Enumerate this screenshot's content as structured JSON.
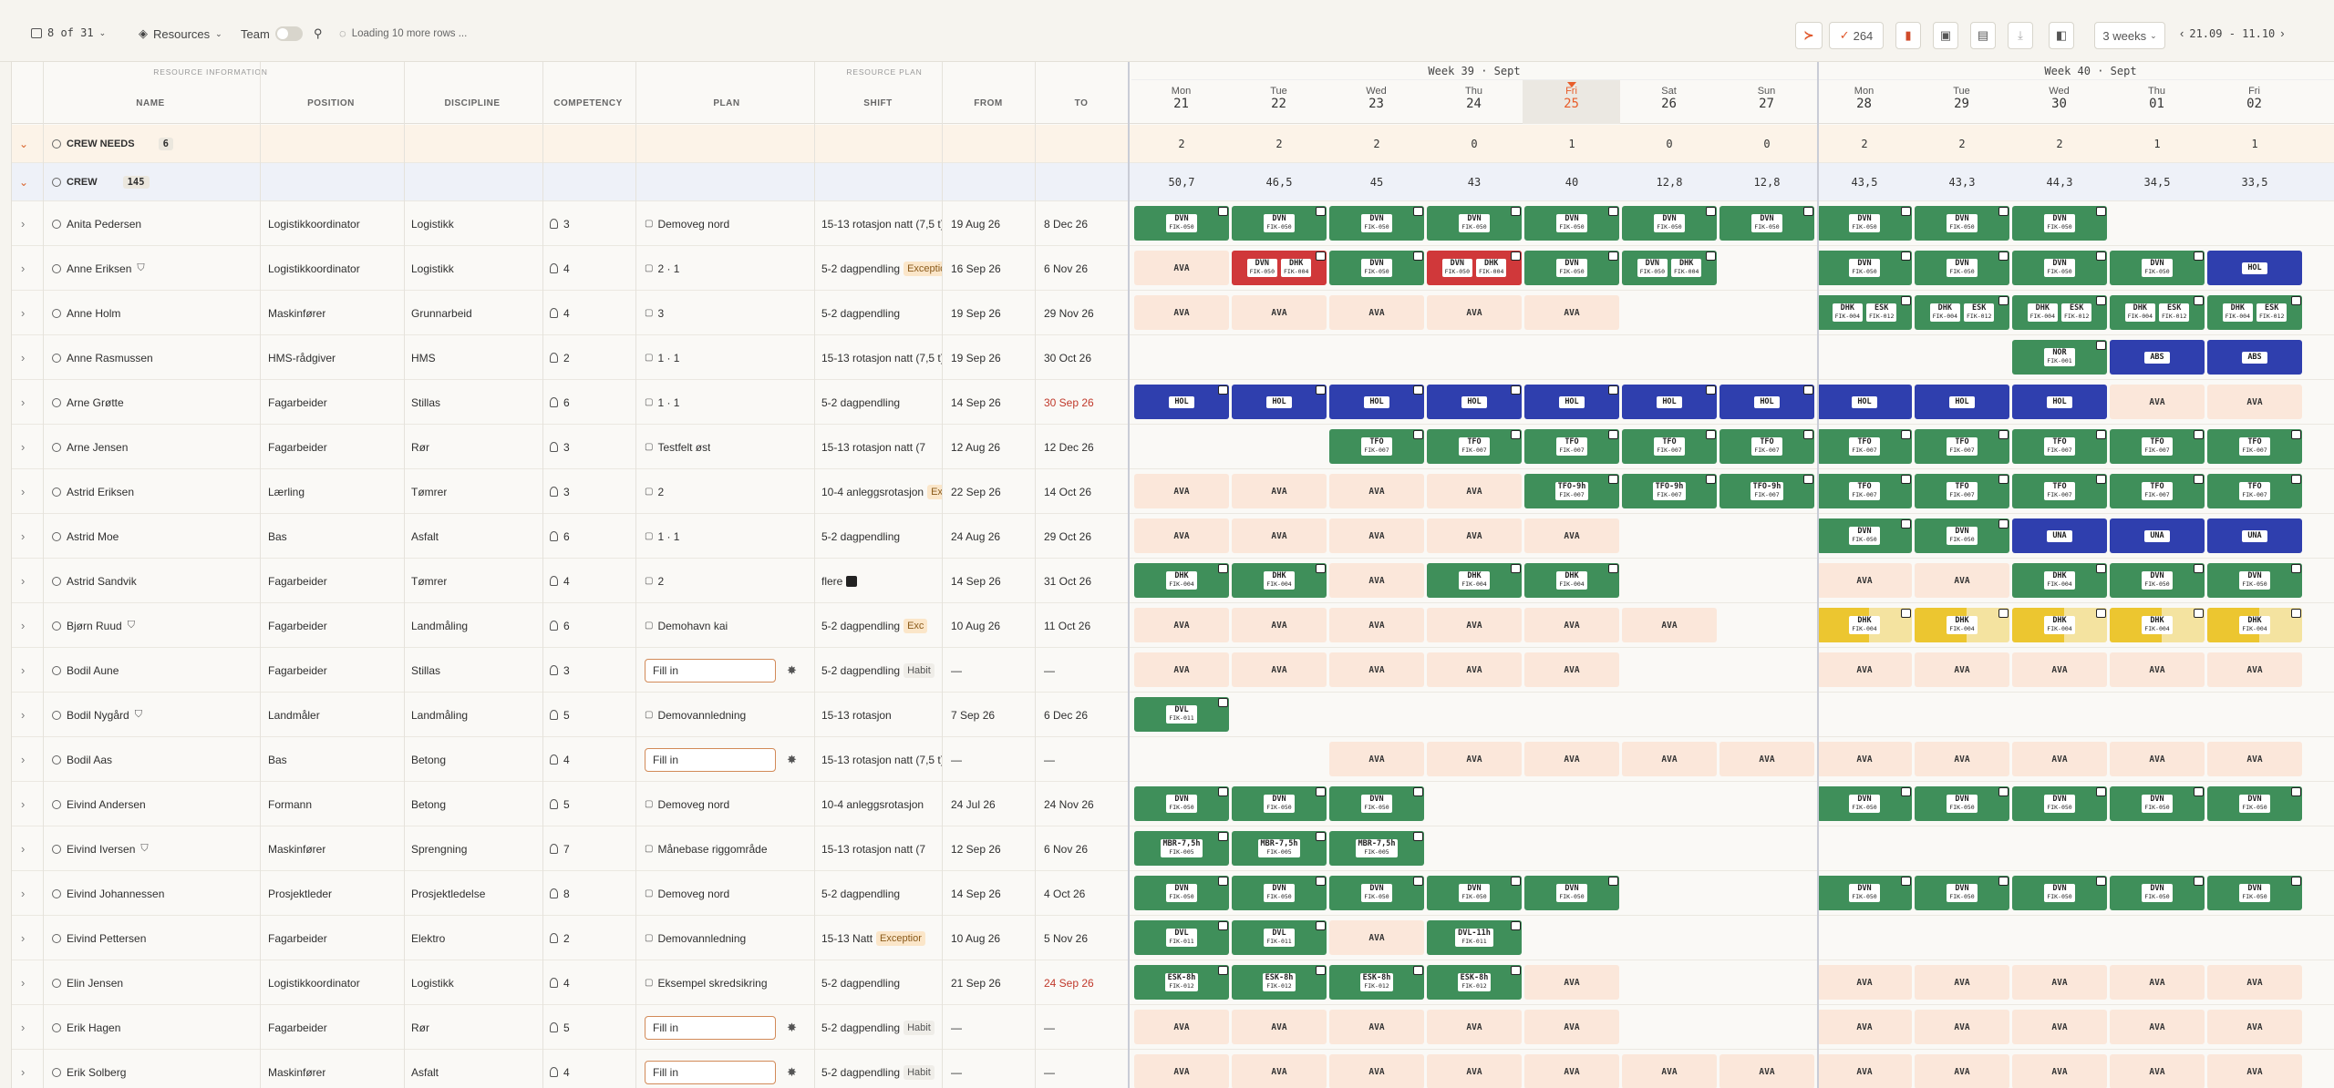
{
  "toolbar": {
    "row_count": "8 of 31",
    "resources_label": "Resources",
    "team_label": "Team",
    "loading_text": "Loading 10 more rows ...",
    "badge_count": "264",
    "range_select": "3 weeks",
    "date_range": "21.09 - 11.10"
  },
  "header": {
    "group_info": "RESOURCE INFORMATION",
    "group_plan": "RESOURCE PLAN",
    "col_name": "NAME",
    "col_position": "POSITION",
    "col_discipline": "DISCIPLINE",
    "col_competency": "COMPETENCY",
    "col_plan": "PLAN",
    "col_shift": "SHIFT",
    "col_from": "FROM",
    "col_to": "TO",
    "week39": "Week 39 · Sept",
    "week40": "Week 40 · Sept",
    "days": [
      {
        "d": "Mon",
        "n": "21"
      },
      {
        "d": "Tue",
        "n": "22"
      },
      {
        "d": "Wed",
        "n": "23"
      },
      {
        "d": "Thu",
        "n": "24"
      },
      {
        "d": "Fri",
        "n": "25"
      },
      {
        "d": "Sat",
        "n": "26"
      },
      {
        "d": "Sun",
        "n": "27"
      },
      {
        "d": "Mon",
        "n": "28"
      },
      {
        "d": "Tue",
        "n": "29"
      },
      {
        "d": "Wed",
        "n": "30"
      },
      {
        "d": "Thu",
        "n": "01"
      },
      {
        "d": "Fri",
        "n": "02"
      }
    ]
  },
  "groups": [
    {
      "label": "CREW NEEDS",
      "count": "6",
      "values": [
        "2",
        "2",
        "2",
        "0",
        "1",
        "0",
        "0",
        "2",
        "2",
        "2",
        "1",
        "1"
      ]
    },
    {
      "label": "CREW",
      "count": "145",
      "values": [
        "50,7",
        "46,5",
        "45",
        "43",
        "40",
        "12,8",
        "12,8",
        "43,5",
        "43,3",
        "44,3",
        "34,5",
        "33,5"
      ]
    }
  ],
  "colors": {
    "green": "#3f8f5a",
    "blue": "#2f3fae",
    "red": "#d0383a",
    "yellow": "#ecc630",
    "ava": "#fbe7da",
    "today": "#e85d2a"
  },
  "rows": [
    {
      "name": "Anita Pedersen",
      "position": "Logistikkoordinator",
      "discipline": "Logistikk",
      "comp": "3",
      "plan": "Demoveg nord",
      "plan_icon": "building",
      "shift": "15-13 rotasjon natt (7,5 t)",
      "from": "19 Aug 26",
      "to": "8 Dec 26",
      "cells": [
        "g:DVN:FIK-050",
        "g:DVN:FIK-050",
        "g:DVN:FIK-050",
        "g:DVN:FIK-050",
        "g:DVN:FIK-050",
        "g:DVN:FIK-050",
        "g:DVN:FIK-050",
        "g:DVN:FIK-050",
        "g:DVN:FIK-050",
        "g:DVN:FIK-050",
        "",
        ""
      ]
    },
    {
      "name": "Anne Eriksen",
      "verified": true,
      "position": "Logistikkoordinator",
      "discipline": "Logistikk",
      "comp": "4",
      "plan": "2 · 1",
      "plan_icon": "multi",
      "shift": "5-2 dagpendling",
      "shift_tag": "Exceptio",
      "from": "16 Sep 26",
      "to": "6 Nov 26",
      "cells": [
        "a",
        "r2:DVN:FIK-050:DHK:FIK-004",
        "g:DVN:FIK-050",
        "r2:DVN:FIK-050:DHK:FIK-004",
        "g:DVN:FIK-050",
        "g2:DVN:FIK-050:DHK:FIK-004",
        "",
        "g:DVN:FIK-050",
        "g:DVN:FIK-050",
        "g:DVN:FIK-050",
        "g:DVN:FIK-050",
        "b:HOL:"
      ]
    },
    {
      "name": "Anne Holm",
      "position": "Maskinfører",
      "discipline": "Grunnarbeid",
      "comp": "4",
      "plan": "3",
      "plan_icon": "multi",
      "shift": "5-2 dagpendling",
      "from": "19 Sep 26",
      "to": "29 Nov 26",
      "cells": [
        "a",
        "a",
        "a",
        "a",
        "a",
        "",
        "",
        "g2:DHK:FIK-004:ESK:FIK-012",
        "g2:DHK:FIK-004:ESK:FIK-012",
        "g2:DHK:FIK-004:ESK:FIK-012",
        "g2:DHK:FIK-004:ESK:FIK-012",
        "g2:DHK:FIK-004:ESK:FIK-012"
      ]
    },
    {
      "name": "Anne Rasmussen",
      "position": "HMS-rådgiver",
      "discipline": "HMS",
      "comp": "2",
      "plan": "1 · 1",
      "plan_icon": "multi",
      "shift": "15-13 rotasjon natt (7,5 t)",
      "from": "19 Sep 26",
      "to": "30 Oct 26",
      "cells": [
        "",
        "",
        "",
        "",
        "",
        "",
        "",
        "",
        "",
        "g:NOR:FIK-001",
        "b:ABS:",
        "b:ABS:"
      ]
    },
    {
      "name": "Arne Grøtte",
      "position": "Fagarbeider",
      "discipline": "Stillas",
      "comp": "6",
      "plan": "1 · 1",
      "plan_icon": "multi",
      "shift": "5-2 dagpendling",
      "from": "14 Sep 26",
      "to": "30 Sep 26",
      "to_red": true,
      "cells": [
        "b:HOL:",
        "b:HOL:",
        "b:HOL:",
        "b:HOL:",
        "b:HOL:",
        "b:HOL:",
        "b:HOL:",
        "b:HOL:",
        "b:HOL:",
        "b:HOL:",
        "a",
        "a"
      ]
    },
    {
      "name": "Arne Jensen",
      "position": "Fagarbeider",
      "discipline": "Rør",
      "comp": "3",
      "plan": "Testfelt øst",
      "plan_icon": "building",
      "shift": "15-13 rotasjon natt (7",
      "from": "12 Aug 26",
      "to": "12 Dec 26",
      "cells": [
        "",
        "",
        "g:TFO:FIK-007",
        "g:TFO:FIK-007",
        "g:TFO:FIK-007",
        "g:TFO:FIK-007",
        "g:TFO:FIK-007",
        "g:TFO:FIK-007",
        "g:TFO:FIK-007",
        "g:TFO:FIK-007",
        "g:TFO:FIK-007",
        "g:TFO:FIK-007"
      ]
    },
    {
      "name": "Astrid Eriksen",
      "position": "Lærling",
      "discipline": "Tømrer",
      "comp": "3",
      "plan": "2",
      "plan_icon": "multi",
      "shift": "10-4 anleggsrotasjon",
      "shift_tag": "Exc",
      "from": "22 Sep 26",
      "to": "14 Oct 26",
      "cells": [
        "a",
        "a",
        "a",
        "a",
        "g:TFO-9h:FIK-007",
        "g:TFO-9h:FIK-007",
        "g:TFO-9h:FIK-007",
        "g:TFO:FIK-007",
        "g:TFO:FIK-007",
        "g:TFO:FIK-007",
        "g:TFO:FIK-007",
        "g:TFO:FIK-007"
      ]
    },
    {
      "name": "Astrid Moe",
      "position": "Bas",
      "discipline": "Asfalt",
      "comp": "6",
      "plan": "1 · 1",
      "plan_icon": "multi",
      "shift": "5-2 dagpendling",
      "from": "24 Aug 26",
      "to": "29 Oct 26",
      "cells": [
        "a",
        "a",
        "a",
        "a",
        "a",
        "",
        "",
        "g:DVN:FIK-050",
        "g:DVN:FIK-050",
        "b:UNA:",
        "b:UNA:",
        "b:UNA:"
      ]
    },
    {
      "name": "Astrid Sandvik",
      "position": "Fagarbeider",
      "discipline": "Tømrer",
      "comp": "4",
      "plan": "2",
      "plan_icon": "multi",
      "shift": "flere",
      "from": "14 Sep 26",
      "to": "31 Oct 26",
      "cells": [
        "g:DHK:FIK-004",
        "g:DHK:FIK-004",
        "a",
        "g:DHK:FIK-004",
        "g:DHK:FIK-004",
        "",
        "",
        "a",
        "a",
        "g:DHK:FIK-004",
        "g:DVN:FIK-050",
        "g:DVN:FIK-050"
      ]
    },
    {
      "name": "Bjørn Ruud",
      "verified": true,
      "position": "Fagarbeider",
      "discipline": "Landmåling",
      "comp": "6",
      "plan": "Demohavn kai",
      "plan_icon": "building",
      "shift": "5-2 dagpendling",
      "shift_tag": "Exc",
      "from": "10 Aug 26",
      "to": "11 Oct 26",
      "cells": [
        "a",
        "a",
        "a",
        "a",
        "a",
        "a",
        "",
        "y:DHK:FIK-004",
        "y:DHK:FIK-004",
        "y:DHK:FIK-004",
        "y:DHK:FIK-004",
        "y:DHK:FIK-004"
      ]
    },
    {
      "name": "Bodil Aune",
      "position": "Fagarbeider",
      "discipline": "Stillas",
      "comp": "3",
      "fill": true,
      "plan": "Fill in",
      "shift": "5-2 dagpendling",
      "shift_tag": "Habit",
      "from": "—",
      "to": "—",
      "cells": [
        "a",
        "a",
        "a",
        "a",
        "a",
        "",
        "",
        "a",
        "a",
        "a",
        "a",
        "a"
      ]
    },
    {
      "name": "Bodil Nygård",
      "verified": true,
      "position": "Landmåler",
      "discipline": "Landmåling",
      "comp": "5",
      "plan": "Demovannledning",
      "plan_icon": "building",
      "shift": "15-13 rotasjon",
      "from": "7 Sep 26",
      "to": "6 Dec 26",
      "cells": [
        "g:DVL:FIK-011",
        "",
        "",
        "",
        "",
        "",
        "",
        "",
        "",
        "",
        "",
        ""
      ]
    },
    {
      "name": "Bodil Aas",
      "position": "Bas",
      "discipline": "Betong",
      "comp": "4",
      "fill": true,
      "plan": "Fill in",
      "shift": "15-13 rotasjon natt (7,5 t)",
      "from": "—",
      "to": "—",
      "cells": [
        "",
        "",
        "a",
        "a",
        "a",
        "a",
        "a",
        "a",
        "a",
        "a",
        "a",
        "a"
      ]
    },
    {
      "name": "Eivind Andersen",
      "position": "Formann",
      "discipline": "Betong",
      "comp": "5",
      "plan": "Demoveg nord",
      "plan_icon": "building",
      "shift": "10-4 anleggsrotasjon",
      "from": "24 Jul 26",
      "to": "24 Nov 26",
      "cells": [
        "g:DVN:FIK-050",
        "g:DVN:FIK-050",
        "g:DVN:FIK-050",
        "",
        "",
        "",
        "",
        "g:DVN:FIK-050",
        "g:DVN:FIK-050",
        "g:DVN:FIK-050",
        "g:DVN:FIK-050",
        "g:DVN:FIK-050"
      ]
    },
    {
      "name": "Eivind Iversen",
      "verified": true,
      "position": "Maskinfører",
      "discipline": "Sprengning",
      "comp": "7",
      "plan": "Månebase riggområde",
      "plan_icon": "building",
      "shift": "15-13 rotasjon natt (7",
      "from": "12 Sep 26",
      "to": "6 Nov 26",
      "cells": [
        "g:MBR-7,5h:FIK-005",
        "g:MBR-7,5h:FIK-005",
        "g:MBR-7,5h:FIK-005",
        "",
        "",
        "",
        "",
        "",
        "",
        "",
        "",
        ""
      ]
    },
    {
      "name": "Eivind Johannessen",
      "position": "Prosjektleder",
      "discipline": "Prosjektledelse",
      "comp": "8",
      "plan": "Demoveg nord",
      "plan_icon": "building",
      "shift": "5-2 dagpendling",
      "from": "14 Sep 26",
      "to": "4 Oct 26",
      "cells": [
        "g:DVN:FIK-050",
        "g:DVN:FIK-050",
        "g:DVN:FIK-050",
        "g:DVN:FIK-050",
        "g:DVN:FIK-050",
        "",
        "",
        "g:DVN:FIK-050",
        "g:DVN:FIK-050",
        "g:DVN:FIK-050",
        "g:DVN:FIK-050",
        "g:DVN:FIK-050"
      ]
    },
    {
      "name": "Eivind Pettersen",
      "position": "Fagarbeider",
      "discipline": "Elektro",
      "comp": "2",
      "plan": "Demovannledning",
      "plan_icon": "building",
      "shift": "15-13 Natt",
      "shift_tag": "Exceptior",
      "from": "10 Aug 26",
      "to": "5 Nov 26",
      "cells": [
        "g:DVL:FIK-011",
        "g:DVL:FIK-011",
        "a",
        "g:DVL-11h:FIK-011",
        "",
        "",
        "",
        "",
        "",
        "",
        "",
        ""
      ]
    },
    {
      "name": "Elin Jensen",
      "position": "Logistikkoordinator",
      "discipline": "Logistikk",
      "comp": "4",
      "plan": "Eksempel skredsikring",
      "plan_icon": "building",
      "shift": "5-2 dagpendling",
      "from": "21 Sep 26",
      "to": "24 Sep 26",
      "to_red": true,
      "cells": [
        "g:ESK-8h:FIK-012",
        "g:ESK-8h:FIK-012",
        "g:ESK-8h:FIK-012",
        "g:ESK-8h:FIK-012",
        "a",
        "",
        "",
        "a",
        "a",
        "a",
        "a",
        "a"
      ]
    },
    {
      "name": "Erik Hagen",
      "position": "Fagarbeider",
      "discipline": "Rør",
      "comp": "5",
      "fill": true,
      "plan": "Fill in",
      "shift": "5-2 dagpendling",
      "shift_tag": "Habit",
      "from": "—",
      "to": "—",
      "cells": [
        "a",
        "a",
        "a",
        "a",
        "a",
        "",
        "",
        "a",
        "a",
        "a",
        "a",
        "a"
      ]
    },
    {
      "name": "Erik Solberg",
      "position": "Maskinfører",
      "discipline": "Asfalt",
      "comp": "4",
      "fill": true,
      "plan": "Fill in",
      "shift": "5-2 dagpendling",
      "shift_tag": "Habit",
      "from": "—",
      "to": "—",
      "cells": [
        "a",
        "a",
        "a",
        "a",
        "a",
        "a",
        "a",
        "a",
        "a",
        "a",
        "a",
        "a"
      ]
    }
  ]
}
